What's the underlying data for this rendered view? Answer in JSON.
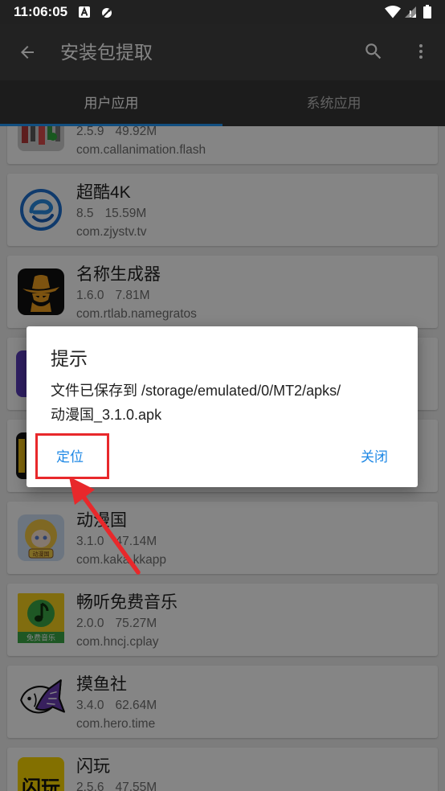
{
  "theme": {
    "accent": "#2196F3",
    "annotation_red": "#e8282b"
  },
  "status_bar": {
    "time": "11:06:05",
    "left_icons": [
      "a-box-notification-icon",
      "app-notification-icon"
    ],
    "right_icons": [
      "wifi-icon",
      "cell-signal-icon",
      "battery-icon"
    ]
  },
  "app_bar": {
    "title": "安装包提取",
    "icons": [
      "arrow-back-icon",
      "search-icon",
      "more-vert-icon"
    ]
  },
  "tabs": [
    {
      "label": "用户应用",
      "selected": true
    },
    {
      "label": "系统应用",
      "selected": false
    }
  ],
  "apps": [
    {
      "version": "2.5.9",
      "size": "49.92M",
      "package": "com.callanimation.flash",
      "icon": "callanimation-app-icon"
    },
    {
      "name": "超酷4K",
      "version": "8.5",
      "size": "15.59M",
      "package": "com.zjystv.tv",
      "icon": "chaoku-4k-app-icon"
    },
    {
      "name": "名称生成器",
      "version": "1.6.0",
      "size": "7.81M",
      "package": "com.rtlab.namegratos",
      "icon": "cowboy-app-icon"
    },
    {
      "icon": "purple-app-icon"
    },
    {
      "icon": "dark-yellow-app-icon"
    },
    {
      "name": "动漫国",
      "version": "3.1.0",
      "size": "47.14M",
      "package": "com.kaka.kkapp",
      "icon": "anime-girl-app-icon",
      "icon_text": "动漫国"
    },
    {
      "name": "畅听免费音乐",
      "version": "2.0.0",
      "size": "75.27M",
      "package": "com.hncj.cplay",
      "icon": "music-note-app-icon",
      "icon_text": "免费音乐"
    },
    {
      "name": "摸鱼社",
      "version": "3.4.0",
      "size": "62.64M",
      "package": "com.hero.time",
      "icon": "fish-app-icon"
    },
    {
      "name": "闪玩",
      "version": "2.5.6",
      "size": "47.55M",
      "icon": "shanwan-app-icon",
      "icon_text": "闪玩"
    }
  ],
  "dialog": {
    "title": "提示",
    "message_lines": [
      "文件已保存到 /storage/emulated/0/MT2/apks/",
      "动漫国_3.1.0.apk"
    ],
    "positive_button": "定位",
    "negative_button": "关闭"
  }
}
